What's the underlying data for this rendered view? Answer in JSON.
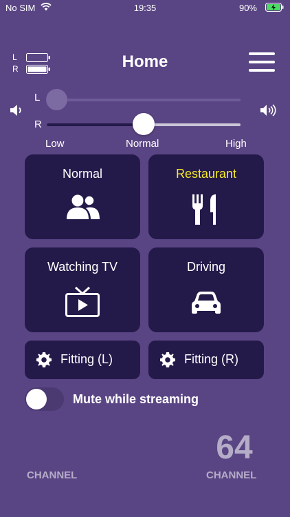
{
  "status": {
    "carrier": "No SIM",
    "time": "19:35",
    "battery_pct": "90%"
  },
  "header": {
    "battery_left_label": "L",
    "battery_right_label": "R",
    "title": "Home",
    "menu_icon": "hamburger-icon"
  },
  "volume": {
    "left_label": "L",
    "right_label": "R",
    "left_level": 0.0,
    "right_level": 0.5,
    "low_label": "Low",
    "normal_label": "Normal",
    "high_label": "High",
    "min_icon": "volume-low-icon",
    "max_icon": "volume-high-icon"
  },
  "programs": [
    {
      "label": "Normal",
      "icon": "people-icon",
      "active": false
    },
    {
      "label": "Restaurant",
      "icon": "fork-knife-icon",
      "active": true
    },
    {
      "label": "Watching TV",
      "icon": "tv-icon",
      "active": false
    },
    {
      "label": "Driving",
      "icon": "car-icon",
      "active": false
    }
  ],
  "fitting": {
    "left_label": "Fitting (L)",
    "right_label": "Fitting (R)",
    "icon": "gear-icon"
  },
  "mute": {
    "label": "Mute while streaming",
    "on": false
  },
  "channels": {
    "left_value": "",
    "left_label": "CHANNEL",
    "right_value": "64",
    "right_label": "CHANNEL"
  },
  "colors": {
    "background": "#5a4584",
    "tile": "#241a4a",
    "active_text": "#f6ea27",
    "muted_text": "#b5acc8"
  }
}
